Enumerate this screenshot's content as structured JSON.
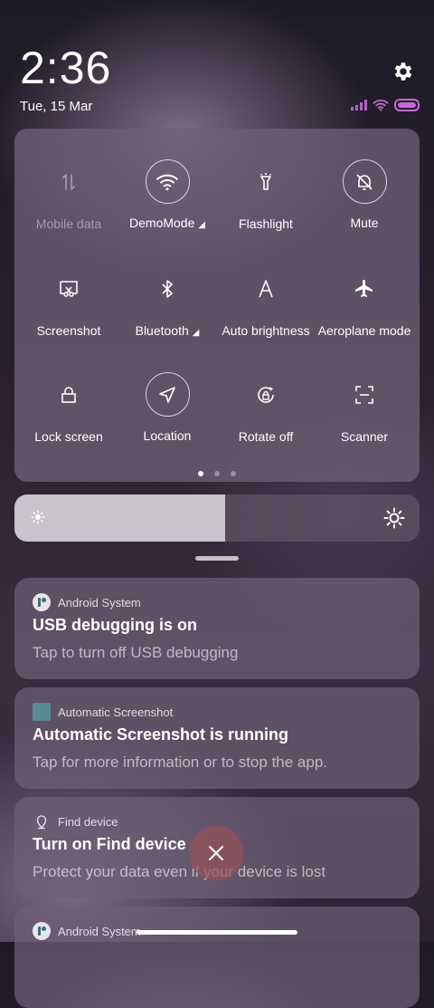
{
  "status": {
    "time": "2:36",
    "date": "Tue, 15 Mar"
  },
  "quick_settings": {
    "tiles": [
      {
        "label": "Mobile data",
        "icon": "mobile-data-icon",
        "state": "disabled"
      },
      {
        "label": "DemoMode",
        "icon": "wifi-icon",
        "state": "active"
      },
      {
        "label": "Flashlight",
        "icon": "flashlight-icon",
        "state": "off"
      },
      {
        "label": "Mute",
        "icon": "mute-bell-icon",
        "state": "active"
      },
      {
        "label": "Screenshot",
        "icon": "screenshot-icon",
        "state": "off"
      },
      {
        "label": "Bluetooth",
        "icon": "bluetooth-icon",
        "state": "off"
      },
      {
        "label": "Auto brightness",
        "icon": "auto-brightness-icon",
        "state": "off"
      },
      {
        "label": "Aeroplane mode",
        "icon": "airplane-icon",
        "state": "off"
      },
      {
        "label": "Lock screen",
        "icon": "lock-icon",
        "state": "off"
      },
      {
        "label": "Location",
        "icon": "location-icon",
        "state": "active"
      },
      {
        "label": "Rotate off",
        "icon": "rotate-lock-icon",
        "state": "off"
      },
      {
        "label": "Scanner",
        "icon": "scanner-icon",
        "state": "off"
      }
    ],
    "pages": 3,
    "current_page": 1
  },
  "brightness": {
    "level": 0.52
  },
  "notifications": [
    {
      "app": "Android System",
      "title": "USB debugging is on",
      "body": "Tap to turn off USB debugging"
    },
    {
      "app": "Automatic Screenshot",
      "title": "Automatic Screenshot is running",
      "body": "Tap for more information or to stop the app."
    },
    {
      "app": "Find device",
      "title": "Turn on Find device",
      "body": "Protect your data even if your device is lost"
    },
    {
      "app": "Android System",
      "title": "",
      "body": ""
    }
  ],
  "colors": {
    "accent": "#c46ad6",
    "panel": "#6e5f76"
  }
}
